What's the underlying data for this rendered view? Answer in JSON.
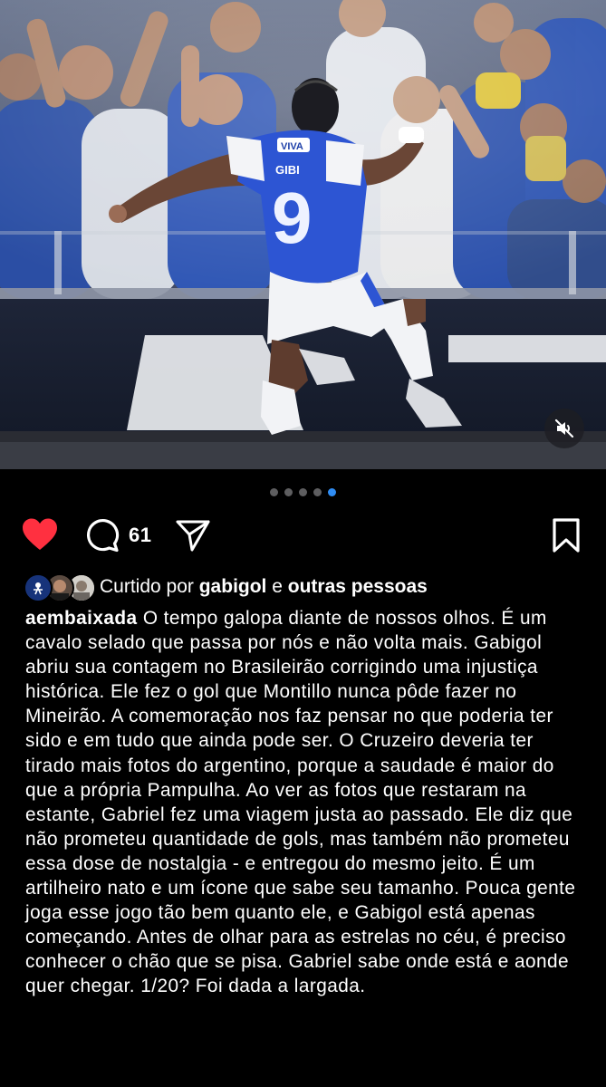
{
  "post": {
    "media": {
      "carousel_total": 5,
      "carousel_active_index": 4,
      "mute_icon": "speaker-muted-icon",
      "jersey_number": "9",
      "jersey_name": "GIBI",
      "sponsor": "VIVA"
    },
    "actions": {
      "like_icon": "heart-filled-icon",
      "like_color": "#ff3040",
      "comment_icon": "comment-bubble-icon",
      "comment_count": "61",
      "share_icon": "paper-plane-icon",
      "save_icon": "bookmark-icon"
    },
    "likes": {
      "prefix": "Curtido por",
      "user": "gabigol",
      "connector": "e",
      "others": "outras pessoas"
    },
    "caption": {
      "username": "aembaixada",
      "text": "O tempo galopa diante de nossos olhos. É um cavalo selado que passa por nós e não volta mais. Gabigol abriu sua contagem no Brasileirão corrigindo uma injustiça histórica. Ele fez o gol que Montillo nunca pôde fazer no Mineirão. A comemoração nos faz pensar no que poderia ter sido e em tudo que ainda pode ser. O Cruzeiro deveria ter tirado mais fotos do argentino, porque a saudade é maior do que a própria Pampulha. Ao ver as fotos que restaram na estante, Gabriel fez uma viagem justa ao passado. Ele diz que não prometeu quantidade de gols, mas também não prometeu essa dose de nostalgia - e entregou do mesmo jeito. É um artilheiro nato e um ícone que sabe seu tamanho. Pouca gente joga esse jogo tão bem quanto ele, e Gabigol está apenas começando. Antes de olhar para as estrelas no céu, é preciso conhecer o chão que se pisa. Gabriel sabe onde está e aonde quer chegar. 1/20? Foi dada a largada."
    }
  }
}
